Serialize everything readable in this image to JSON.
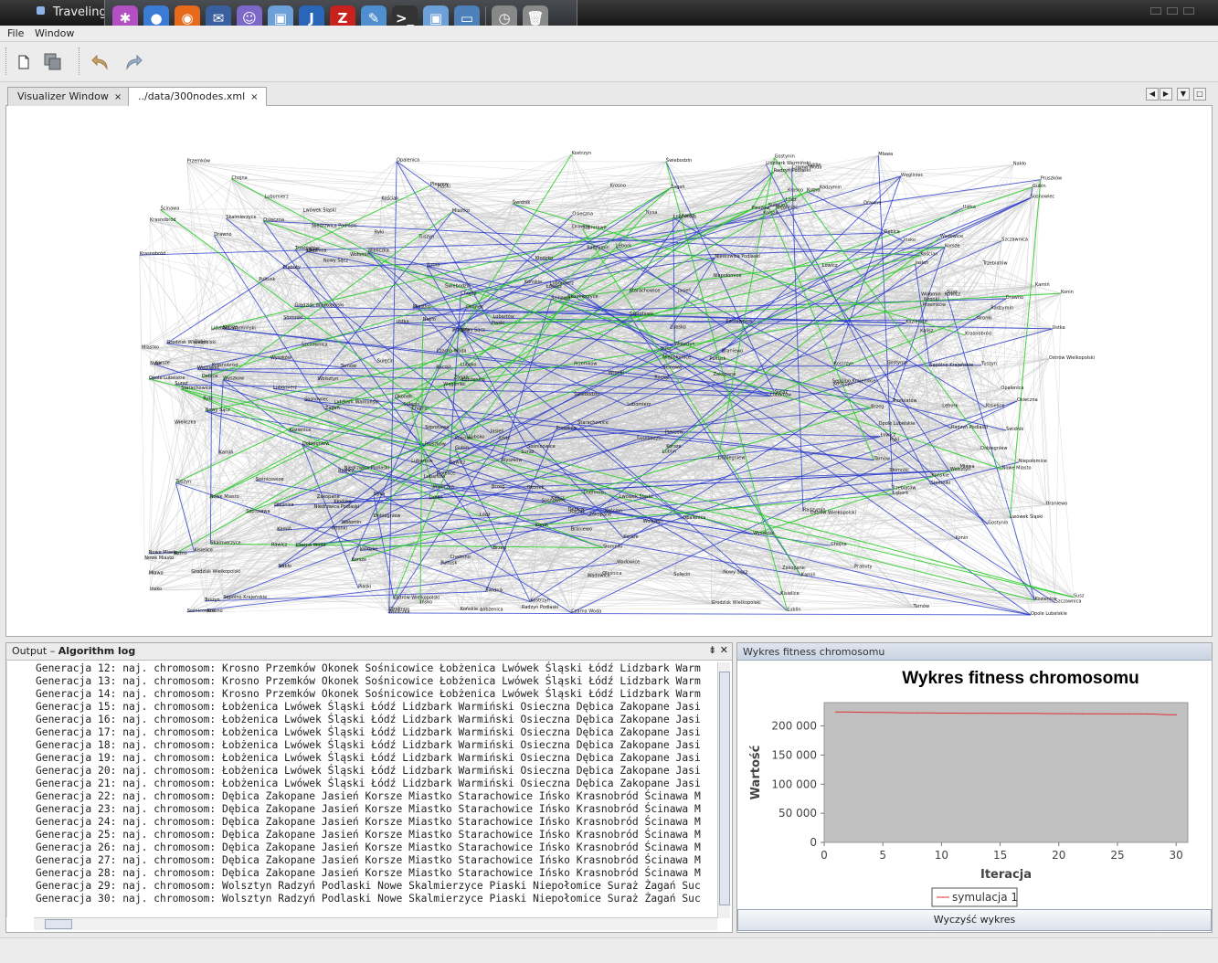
{
  "window": {
    "title": "TravelingSales..."
  },
  "dock_icons": [
    {
      "name": "settings-icon",
      "glyph": "✱",
      "color": "#b24fc2"
    },
    {
      "name": "browser-icon",
      "glyph": "●",
      "color": "#3a7bd5"
    },
    {
      "name": "firefox-icon",
      "glyph": "◉",
      "color": "#e66a1a"
    },
    {
      "name": "thunderbird-icon",
      "glyph": "✉",
      "color": "#3a5f9e"
    },
    {
      "name": "chat-icon",
      "glyph": "☺",
      "color": "#7b68c8"
    },
    {
      "name": "cube-icon",
      "glyph": "▣",
      "color": "#6d9fd9"
    },
    {
      "name": "java-icon",
      "glyph": "J",
      "color": "#2a66b8"
    },
    {
      "name": "filezilla-icon",
      "glyph": "Z",
      "color": "#c9211e"
    },
    {
      "name": "feather-icon",
      "glyph": "✎",
      "color": "#4f8fd0"
    },
    {
      "name": "terminal-icon",
      "glyph": ">_",
      "color": "#333333"
    },
    {
      "name": "package-icon",
      "glyph": "▣",
      "color": "#6d9fd9"
    },
    {
      "name": "display-icon",
      "glyph": "▭",
      "color": "#4d7fb8"
    },
    {
      "name": "clock-icon",
      "glyph": "◷",
      "color": "#888888"
    },
    {
      "name": "trash-icon",
      "glyph": "🗑",
      "color": "#8a8a8a"
    }
  ],
  "menu": {
    "file": "File",
    "window": "Window"
  },
  "tabs": [
    {
      "label": "Visualizer Window",
      "close": "×"
    },
    {
      "label": "../data/300nodes.xml",
      "close": "×"
    }
  ],
  "graph": {
    "labels": [
      "Nowe Miasto",
      "Wieliczka",
      "Lublin",
      "Dobiegniew",
      "Niedrzwica Podlaski",
      "Kostrzyn",
      "Krasnobród",
      "Radzymin",
      "Świebodzin",
      "Szczawnica",
      "Łódź",
      "Czarna Woda",
      "Węgliniec",
      "Kamiń",
      "Wolsztyn",
      "Chojna",
      "Tuszyn",
      "Rawicz",
      "Wronki",
      "Korsze",
      "Lubartów",
      "Nowy Sącz",
      "Drawno",
      "Słomniki",
      "Zakopane",
      "Trzebiatów",
      "Kisielice",
      "Kościan",
      "Szprotawa",
      "Grodzisk Wielkopolski",
      "Lubomierz",
      "Sulęcin",
      "Wyszków",
      "Wołomin",
      "Kozienice",
      "Pruszków",
      "Debica",
      "Ostrów Wielkopolski",
      "Sępólno Krajeńskie",
      "Oleśnica",
      "Łowicz",
      "Tarnów",
      "Końskie",
      "Chełmno",
      "Opalenica",
      "Brzeg",
      "Kutno",
      "Piaski",
      "Sosnowiec",
      "Lidzbark Warmiński",
      "Jasień",
      "Miastko",
      "Starachowice",
      "Ińsko",
      "Ścinawa",
      "Raciąż",
      "Wadowice",
      "Konin",
      "Pułtusk",
      "Lubsko",
      "Pleszew",
      "Mława",
      "Nakło",
      "Braniewo",
      "Lębork",
      "Gostynin",
      "Susz",
      "Kalisz",
      "Prabuty",
      "Ryki",
      "Ustka",
      "Żagań",
      "Suraż",
      "Niepołomice",
      "Skalmierzyce",
      "Radzyń Podlaski",
      "Krosno",
      "Przemków",
      "Okonek",
      "Sośnicowice",
      "Łobżenica",
      "Lwówek Śląski",
      "Osieczna",
      "Korsze",
      "Opole Lubelskie",
      "Świdnik",
      "Kłodzko",
      "Nysa",
      "Gubin"
    ],
    "node_count": 300
  },
  "output": {
    "header_prefix": "Output – ",
    "header_title": "Algorithm log",
    "lines": [
      "Generacja 12: naj. chromosom: Krosno Przemków Okonek Sośnicowice Łobżenica Lwówek Śląski Łódź Lidzbark Warm",
      "Generacja 13: naj. chromosom: Krosno Przemków Okonek Sośnicowice Łobżenica Lwówek Śląski Łódź Lidzbark Warm",
      "Generacja 14: naj. chromosom: Krosno Przemków Okonek Sośnicowice Łobżenica Lwówek Śląski Łódź Lidzbark Warm",
      "Generacja 15: naj. chromosom: Łobżenica Lwówek Śląski Łódź Lidzbark Warmiński Osieczna Dębica Zakopane Jasi",
      "Generacja 16: naj. chromosom: Łobżenica Lwówek Śląski Łódź Lidzbark Warmiński Osieczna Dębica Zakopane Jasi",
      "Generacja 17: naj. chromosom: Łobżenica Lwówek Śląski Łódź Lidzbark Warmiński Osieczna Dębica Zakopane Jasi",
      "Generacja 18: naj. chromosom: Łobżenica Lwówek Śląski Łódź Lidzbark Warmiński Osieczna Dębica Zakopane Jasi",
      "Generacja 19: naj. chromosom: Łobżenica Lwówek Śląski Łódź Lidzbark Warmiński Osieczna Dębica Zakopane Jasi",
      "Generacja 20: naj. chromosom: Łobżenica Lwówek Śląski Łódź Lidzbark Warmiński Osieczna Dębica Zakopane Jasi",
      "Generacja 21: naj. chromosom: Łobżenica Lwówek Śląski Łódź Lidzbark Warmiński Osieczna Dębica Zakopane Jasi",
      "Generacja 22: naj. chromosom: Dębica Zakopane Jasień Korsze Miastko Starachowice Ińsko Krasnobród Ścinawa M",
      "Generacja 23: naj. chromosom: Dębica Zakopane Jasień Korsze Miastko Starachowice Ińsko Krasnobród Ścinawa M",
      "Generacja 24: naj. chromosom: Dębica Zakopane Jasień Korsze Miastko Starachowice Ińsko Krasnobród Ścinawa M",
      "Generacja 25: naj. chromosom: Dębica Zakopane Jasień Korsze Miastko Starachowice Ińsko Krasnobród Ścinawa M",
      "Generacja 26: naj. chromosom: Dębica Zakopane Jasień Korsze Miastko Starachowice Ińsko Krasnobród Ścinawa M",
      "Generacja 27: naj. chromosom: Dębica Zakopane Jasień Korsze Miastko Starachowice Ińsko Krasnobród Ścinawa M",
      "Generacja 28: naj. chromosom: Dębica Zakopane Jasień Korsze Miastko Starachowice Ińsko Krasnobród Ścinawa M",
      "Generacja 29: naj. chromosom: Wolsztyn Radzyń Podlaski Nowe Skalmierzyce Piaski Niepołomice Suraż Żagań Suc",
      "Generacja 30: naj. chromosom: Wolsztyn Radzyń Podlaski Nowe Skalmierzyce Piaski Niepołomice Suraż Żagań Suc"
    ]
  },
  "chart_panel": {
    "header": "Wykres fitness chromosomu",
    "clear_button": "Wyczyść wykres"
  },
  "chart_data": {
    "type": "line",
    "title": "Wykres fitness chromosomu",
    "xlabel": "Iteracja",
    "ylabel": "Wartość",
    "xlim": [
      0,
      31
    ],
    "ylim": [
      0,
      240000
    ],
    "xticks": [
      "0",
      "5",
      "10",
      "15",
      "20",
      "25",
      "30"
    ],
    "yticks": [
      "0",
      "50 000",
      "100 000",
      "150 000",
      "200 000"
    ],
    "grid": false,
    "legend": "bottom",
    "series": [
      {
        "name": "symulacja 1",
        "color": "#e03030",
        "x": [
          1,
          2,
          3,
          4,
          5,
          6,
          7,
          8,
          9,
          10,
          11,
          12,
          13,
          14,
          15,
          16,
          17,
          18,
          19,
          20,
          21,
          22,
          23,
          24,
          25,
          26,
          27,
          28,
          29,
          30
        ],
        "y": [
          224000,
          224000,
          223500,
          223000,
          223000,
          222800,
          222500,
          222500,
          222300,
          222000,
          222000,
          221800,
          221800,
          221800,
          221500,
          221500,
          221500,
          221500,
          221200,
          221000,
          221000,
          220800,
          220800,
          220800,
          220600,
          220600,
          220600,
          220400,
          219500,
          219000
        ]
      }
    ]
  }
}
